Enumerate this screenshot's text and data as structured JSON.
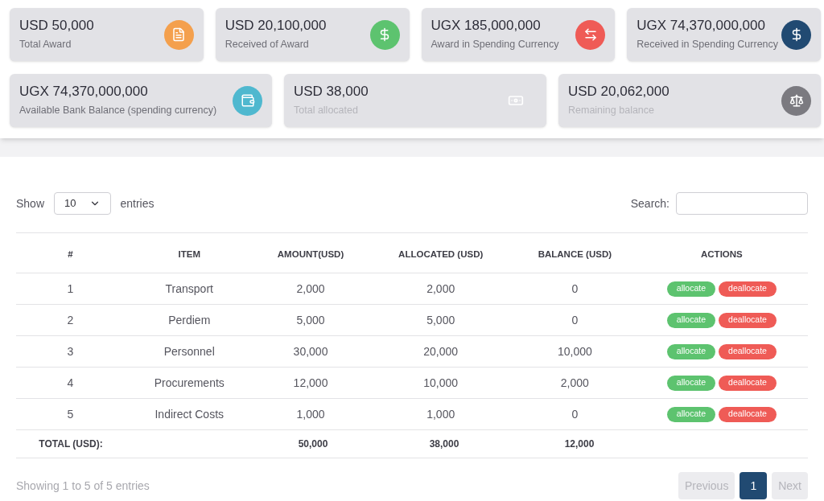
{
  "summary_cards": [
    {
      "value": "USD 50,000",
      "label": "Total Award",
      "muted": false,
      "kind": "file",
      "color": "#f4a04d"
    },
    {
      "value": "USD 20,100,000",
      "label": "Received of Award",
      "muted": false,
      "kind": "dollar",
      "color": "#5dc36f"
    },
    {
      "value": "UGX 185,000,000",
      "label": "Award in Spending Currency",
      "muted": false,
      "kind": "swap",
      "color": "#ef5b56"
    },
    {
      "value": "UGX 74,370,000,000",
      "label": "Received in Spending Currency",
      "muted": false,
      "kind": "dollar",
      "color": "#214a72"
    },
    {
      "value": "UGX 74,370,000,000",
      "label": "Available Bank Balance (spending currency)",
      "muted": false,
      "kind": "wallet",
      "color": "#4fb8cf"
    },
    {
      "value": "USD 38,000",
      "label": "Total allocated",
      "muted": true,
      "kind": "banknote"
    },
    {
      "value": "USD 20,062,000",
      "label": "Remaining balance",
      "muted": true,
      "kind": "scale",
      "color": "#7b7a80"
    }
  ],
  "table_controls": {
    "show_label": "Show",
    "page_size": "10",
    "entries_label": "entries",
    "search_label": "Search:"
  },
  "table": {
    "columns": [
      "#",
      "ITEM",
      "AMOUNT(USD)",
      "ALLOCATED (USD)",
      "BALANCE (USD)",
      "ACTIONS"
    ],
    "rows": [
      {
        "number": "1",
        "item": "Transport",
        "amount": "2,000",
        "allocated": "2,000",
        "balance": "0",
        "actions": [
          "allocate",
          "deallocate"
        ]
      },
      {
        "number": "2",
        "item": "Perdiem",
        "amount": "5,000",
        "allocated": "5,000",
        "balance": "0",
        "actions": [
          "allocate",
          "deallocate"
        ]
      },
      {
        "number": "3",
        "item": "Personnel",
        "amount": "30,000",
        "allocated": "20,000",
        "balance": "10,000",
        "actions": [
          "allocate",
          "deallocate"
        ]
      },
      {
        "number": "4",
        "item": "Procurements",
        "amount": "12,000",
        "allocated": "10,000",
        "balance": "2,000",
        "actions": [
          "allocate",
          "deallocate"
        ]
      },
      {
        "number": "5",
        "item": "Indirect Costs",
        "amount": "1,000",
        "allocated": "1,000",
        "balance": "0",
        "actions": [
          "allocate",
          "deallocate"
        ]
      }
    ],
    "total": {
      "label": "TOTAL (USD):",
      "amount": "50,000",
      "allocated": "38,000",
      "balance": "12,000"
    }
  },
  "footer": {
    "info": "Showing 1 to 5 of 5 entries",
    "pagination": [
      {
        "label": "Previous",
        "kind": "nav",
        "disabled": true,
        "selected": false
      },
      {
        "label": "1",
        "kind": "page",
        "disabled": false,
        "selected": true
      },
      {
        "label": "Next",
        "kind": "nav",
        "disabled": true,
        "selected": false
      }
    ]
  }
}
